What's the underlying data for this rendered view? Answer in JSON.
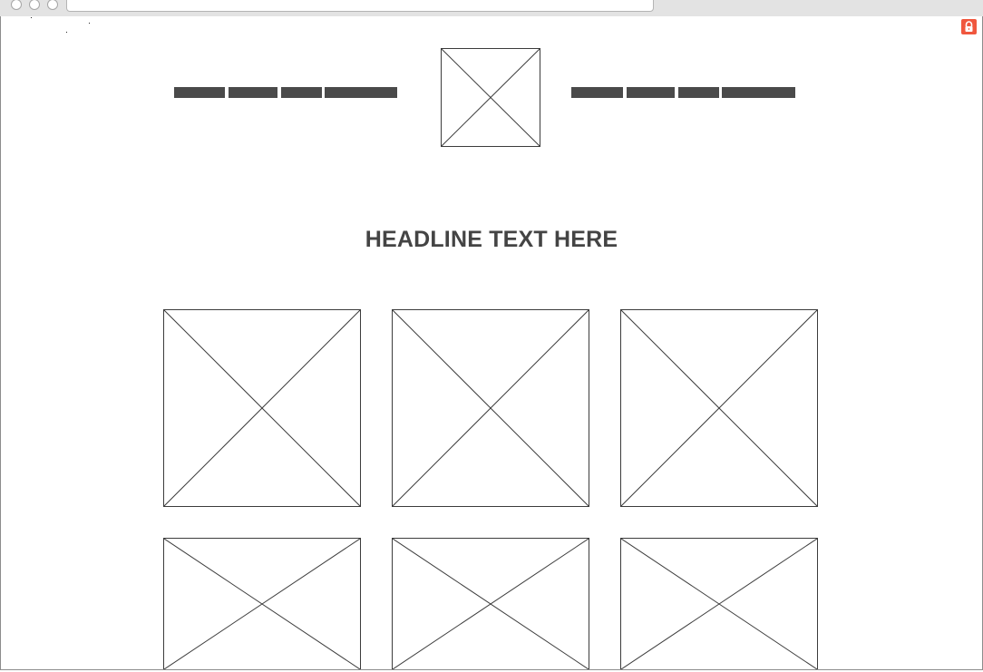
{
  "browser": {
    "address_value": ""
  },
  "colors": {
    "lock_badge": "#f0573e",
    "nav_bar": "#4a4a4a",
    "headline": "#444444"
  },
  "header": {
    "nav_left_items": [
      "",
      "",
      "",
      ""
    ],
    "logo_icon": "image-placeholder-icon",
    "nav_right_items": [
      "",
      "",
      "",
      ""
    ]
  },
  "main": {
    "headline": "HEADLINE TEXT HERE",
    "grid_row_1": [
      "image-placeholder-icon",
      "image-placeholder-icon",
      "image-placeholder-icon"
    ],
    "grid_row_2": [
      "image-placeholder-icon",
      "image-placeholder-icon",
      "image-placeholder-icon"
    ]
  },
  "security": {
    "icon": "lock-icon"
  }
}
